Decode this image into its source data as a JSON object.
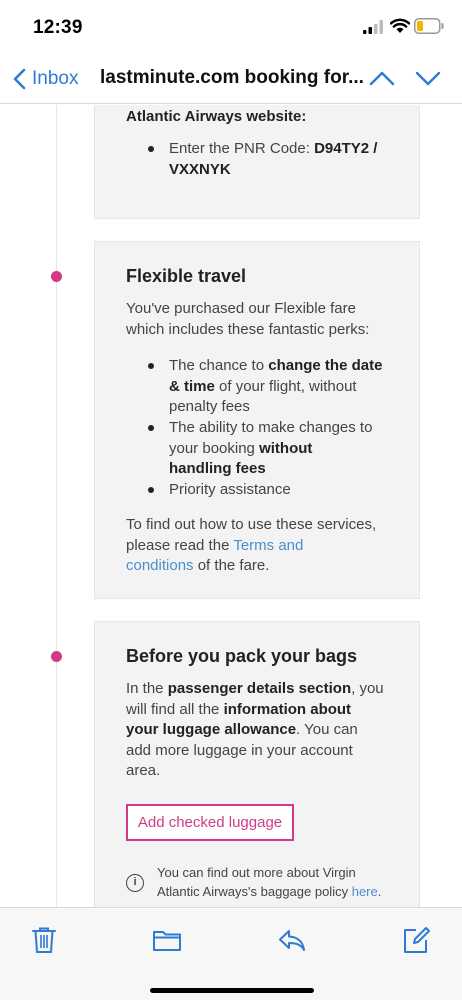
{
  "status_bar": {
    "time": "12:39"
  },
  "nav": {
    "back_label": "Inbox",
    "title": "lastminute.com booking for..."
  },
  "card1": {
    "heading": "Atlantic Airways website:",
    "bullet_prefix": "Enter the PNR Code:",
    "bullet_bold_1": "D94TY2 /",
    "bullet_bold_2": "VXXNYK"
  },
  "flexible": {
    "title": "Flexible travel",
    "intro_1": "You've purchased our Flexible fare",
    "intro_2": "which includes these fantastic perks:",
    "bullet1_a": "The chance to",
    "bullet1_b": "change the date",
    "bullet1_c": "& time",
    "bullet1_d": "of your flight, without",
    "bullet1_e": "penalty fees",
    "bullet2_a": "The ability to make changes to",
    "bullet2_b": "your booking",
    "bullet2_c": "without",
    "bullet2_d": "handling fees",
    "bullet3": "Priority assistance",
    "outro_1": "To find out how to use these services,",
    "outro_2": "please read the",
    "outro_link_1": "Terms and",
    "outro_link_2": "conditions",
    "outro_3": "of the fare."
  },
  "bags": {
    "title": "Before you pack your bags",
    "p1_a": "In the",
    "p1_b": "passenger details section",
    "p1_c": ", you",
    "p2_a": "will find all the",
    "p2_b": "information about",
    "p3_a": "your luggage allowance",
    "p3_b": ". You can",
    "p4": "add more luggage in your account",
    "p5": "area.",
    "button": "Add checked luggage",
    "info_icon": "i",
    "info_1": "You can find out more about Virgin",
    "info_2": "Atlantic Airways's baggage policy",
    "info_link": "here",
    "info_end": "."
  },
  "colors": {
    "accent": "#d33a86",
    "link": "#4a8fcc",
    "ios_blue": "#2f7bd3"
  },
  "icons": [
    "cellular-signal-icon",
    "wifi-icon",
    "battery-icon",
    "chevron-left-icon",
    "chevron-up-icon",
    "chevron-down-icon",
    "info-icon",
    "trash-icon",
    "folder-icon",
    "reply-icon",
    "compose-icon"
  ]
}
